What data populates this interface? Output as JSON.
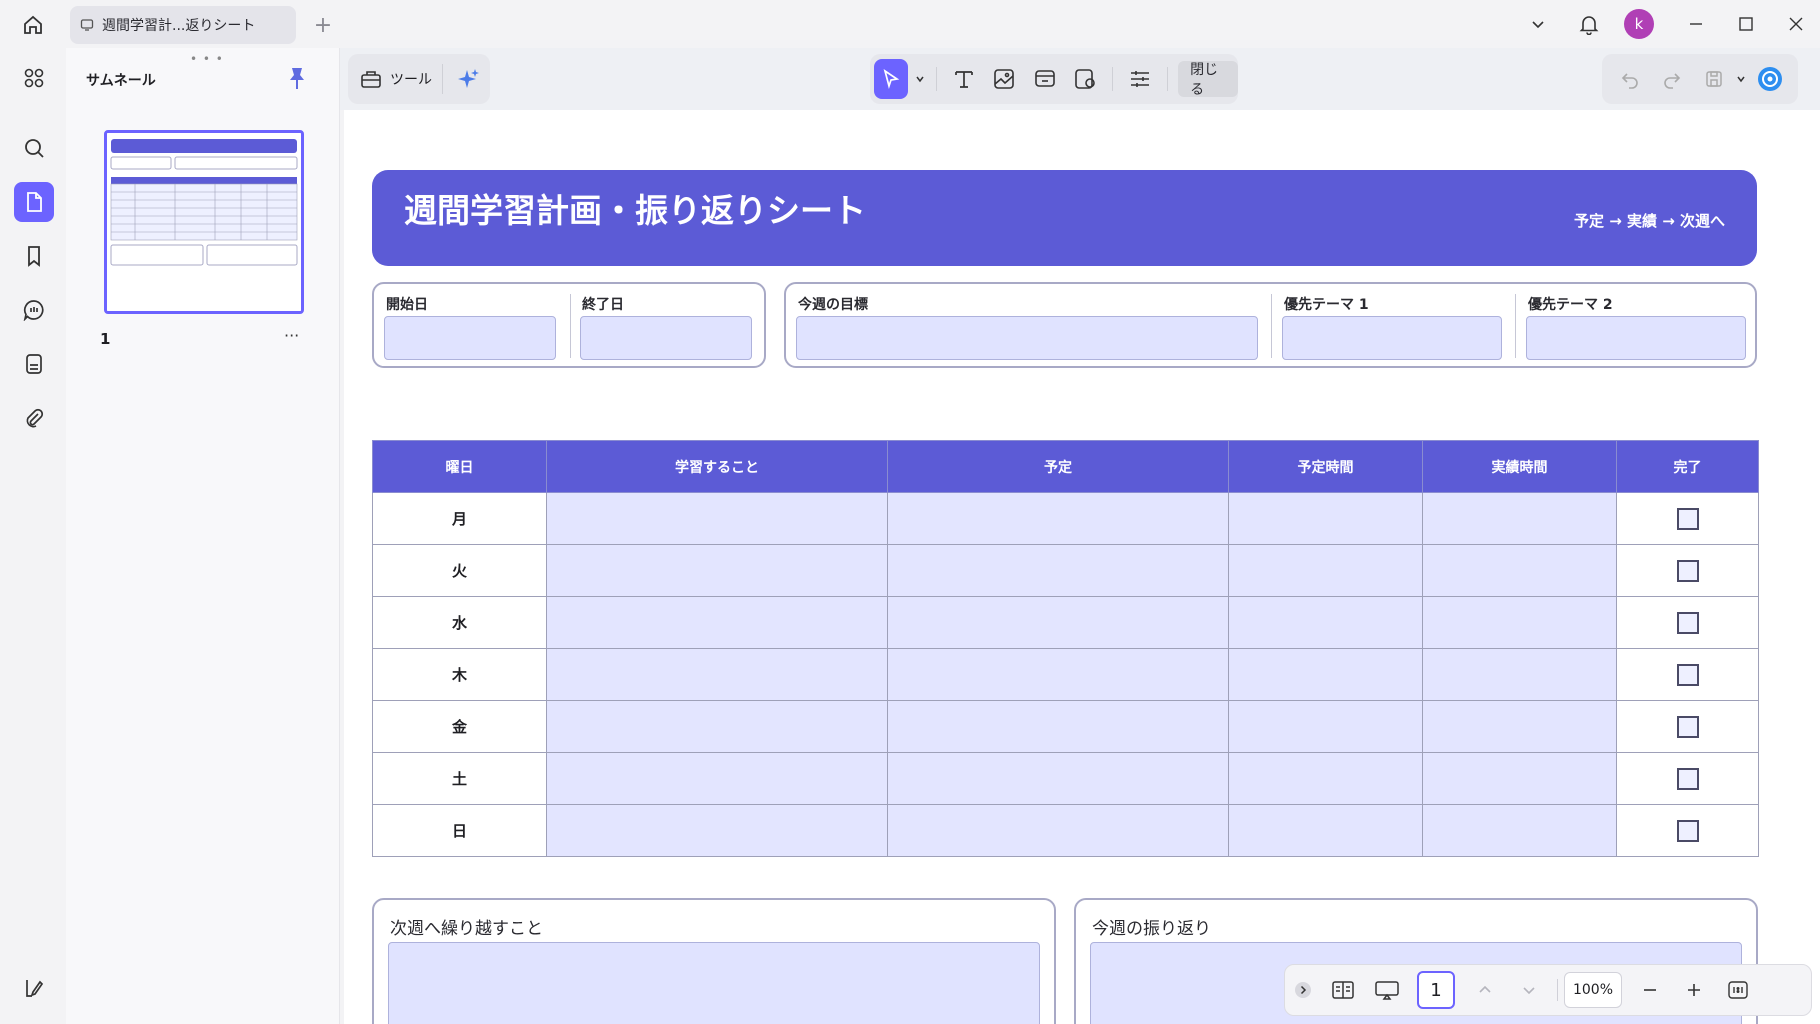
{
  "window": {
    "tab_title": "週間学習計...返りシート",
    "avatar_letter": "k"
  },
  "panel": {
    "title": "サムネール",
    "page_number": "1",
    "more": "···"
  },
  "toolbar": {
    "tools_label": "ツール",
    "close_label": "閉じる"
  },
  "document": {
    "title": "週間学習計画・振り返りシート",
    "subtitle": "予定 → 実績 → 次週へ",
    "fields": {
      "start_date": "開始日",
      "end_date": "終了日",
      "weekly_goal": "今週の目標",
      "priority1": "優先テーマ 1",
      "priority2": "優先テーマ 2"
    },
    "table": {
      "headers": [
        "曜日",
        "学習すること",
        "予定",
        "予定時間",
        "実績時間",
        "完了"
      ],
      "days": [
        "月",
        "火",
        "水",
        "木",
        "金",
        "土",
        "日"
      ]
    },
    "bottom": {
      "carry_over": "次週へ繰り越すこと",
      "reflection": "今週の振り返り"
    }
  },
  "navbar": {
    "page": "1",
    "zoom": "100%"
  },
  "colors": {
    "accent": "#6c63ff",
    "banner": "#5c5bd6",
    "field_fill": "#e0e3ff",
    "avatar": "#b03fb5"
  }
}
